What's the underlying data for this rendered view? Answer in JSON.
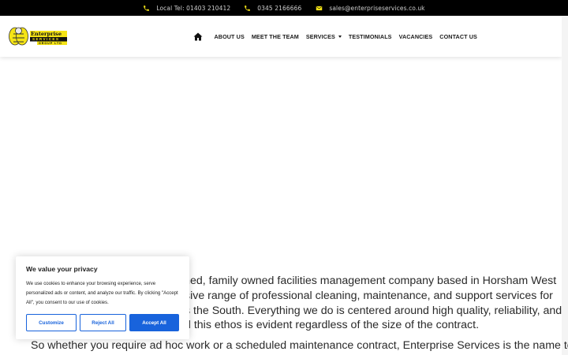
{
  "topbar": {
    "local_tel": "Local Tel: 01403 210412",
    "phone": "0345 2166666",
    "email": "sales@enterpriseservices.co.uk",
    "icon_color": "#f5e416"
  },
  "logo": {
    "line1": "Enterprise",
    "line2": "SERVICES",
    "line3": "GROUP LTD"
  },
  "nav": {
    "items": [
      "ABOUT US",
      "MEET THE TEAM",
      "SERVICES",
      "TESTIMONIALS",
      "VACANCIES",
      "CONTACT US"
    ]
  },
  "content": {
    "line1": "shed, family owned facilities management company based in Horsham West",
    "line2": "sive range of professional cleaning, maintenance, and support services for",
    "line3": "s the South. Everything we do is centered around high quality, reliability, and",
    "line4": "d this ethos is evident regardless of the size of the contract.",
    "line5": "So whether you require ad hoc work or a scheduled maintenance contract, Enterprise Services is the name to"
  },
  "cookie": {
    "title": "We value your privacy",
    "body": "We use cookies to enhance your browsing experience, serve personalized ads or content, and analyze our traffic. By clicking \"Accept All\", you consent to our use of cookies.",
    "customize": "Customize",
    "reject": "Reject All",
    "accept": "Accept All",
    "accent": "#1863dc"
  }
}
